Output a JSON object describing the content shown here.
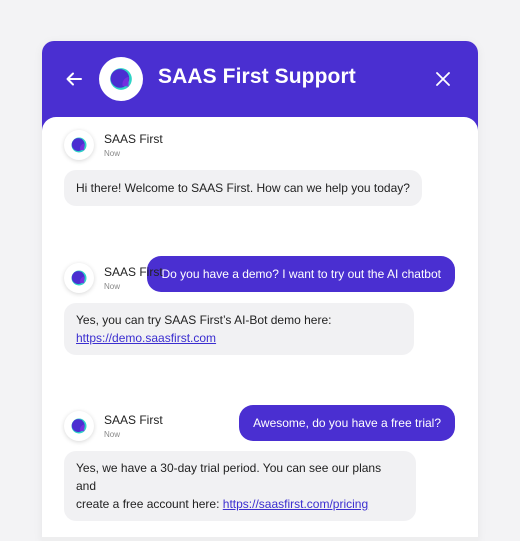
{
  "header": {
    "title": "SAAS First Support"
  },
  "messages": [
    {
      "sender": "SAAS First",
      "time": "Now",
      "text": "Hi there! Welcome to SAAS First. How can we help you today?"
    },
    {
      "user_text": "Do you have a demo? I want to try out the AI chatbot"
    },
    {
      "sender": "SAAS First",
      "time": "Now",
      "text": "Yes, you can try SAAS First’s AI-Bot demo here:",
      "link": "https://demo.saasfirst.com"
    },
    {
      "user_text": "Awesome, do you have a free trial?"
    },
    {
      "sender": "SAAS First",
      "time": "Now",
      "text_line1": "Yes, we have a 30-day trial period. You can see our plans and",
      "text_line2_prefix": "create a free account here: ",
      "link": "https://saasfirst.com/pricing"
    }
  ],
  "colors": {
    "brand": "#4a2fd1",
    "bot_bubble": "#f1f1f3",
    "logo_accent": "#2ed3c6"
  },
  "icons": {
    "back": "arrow-left-icon",
    "close": "close-icon",
    "logo": "saasfirst-logo-icon"
  }
}
